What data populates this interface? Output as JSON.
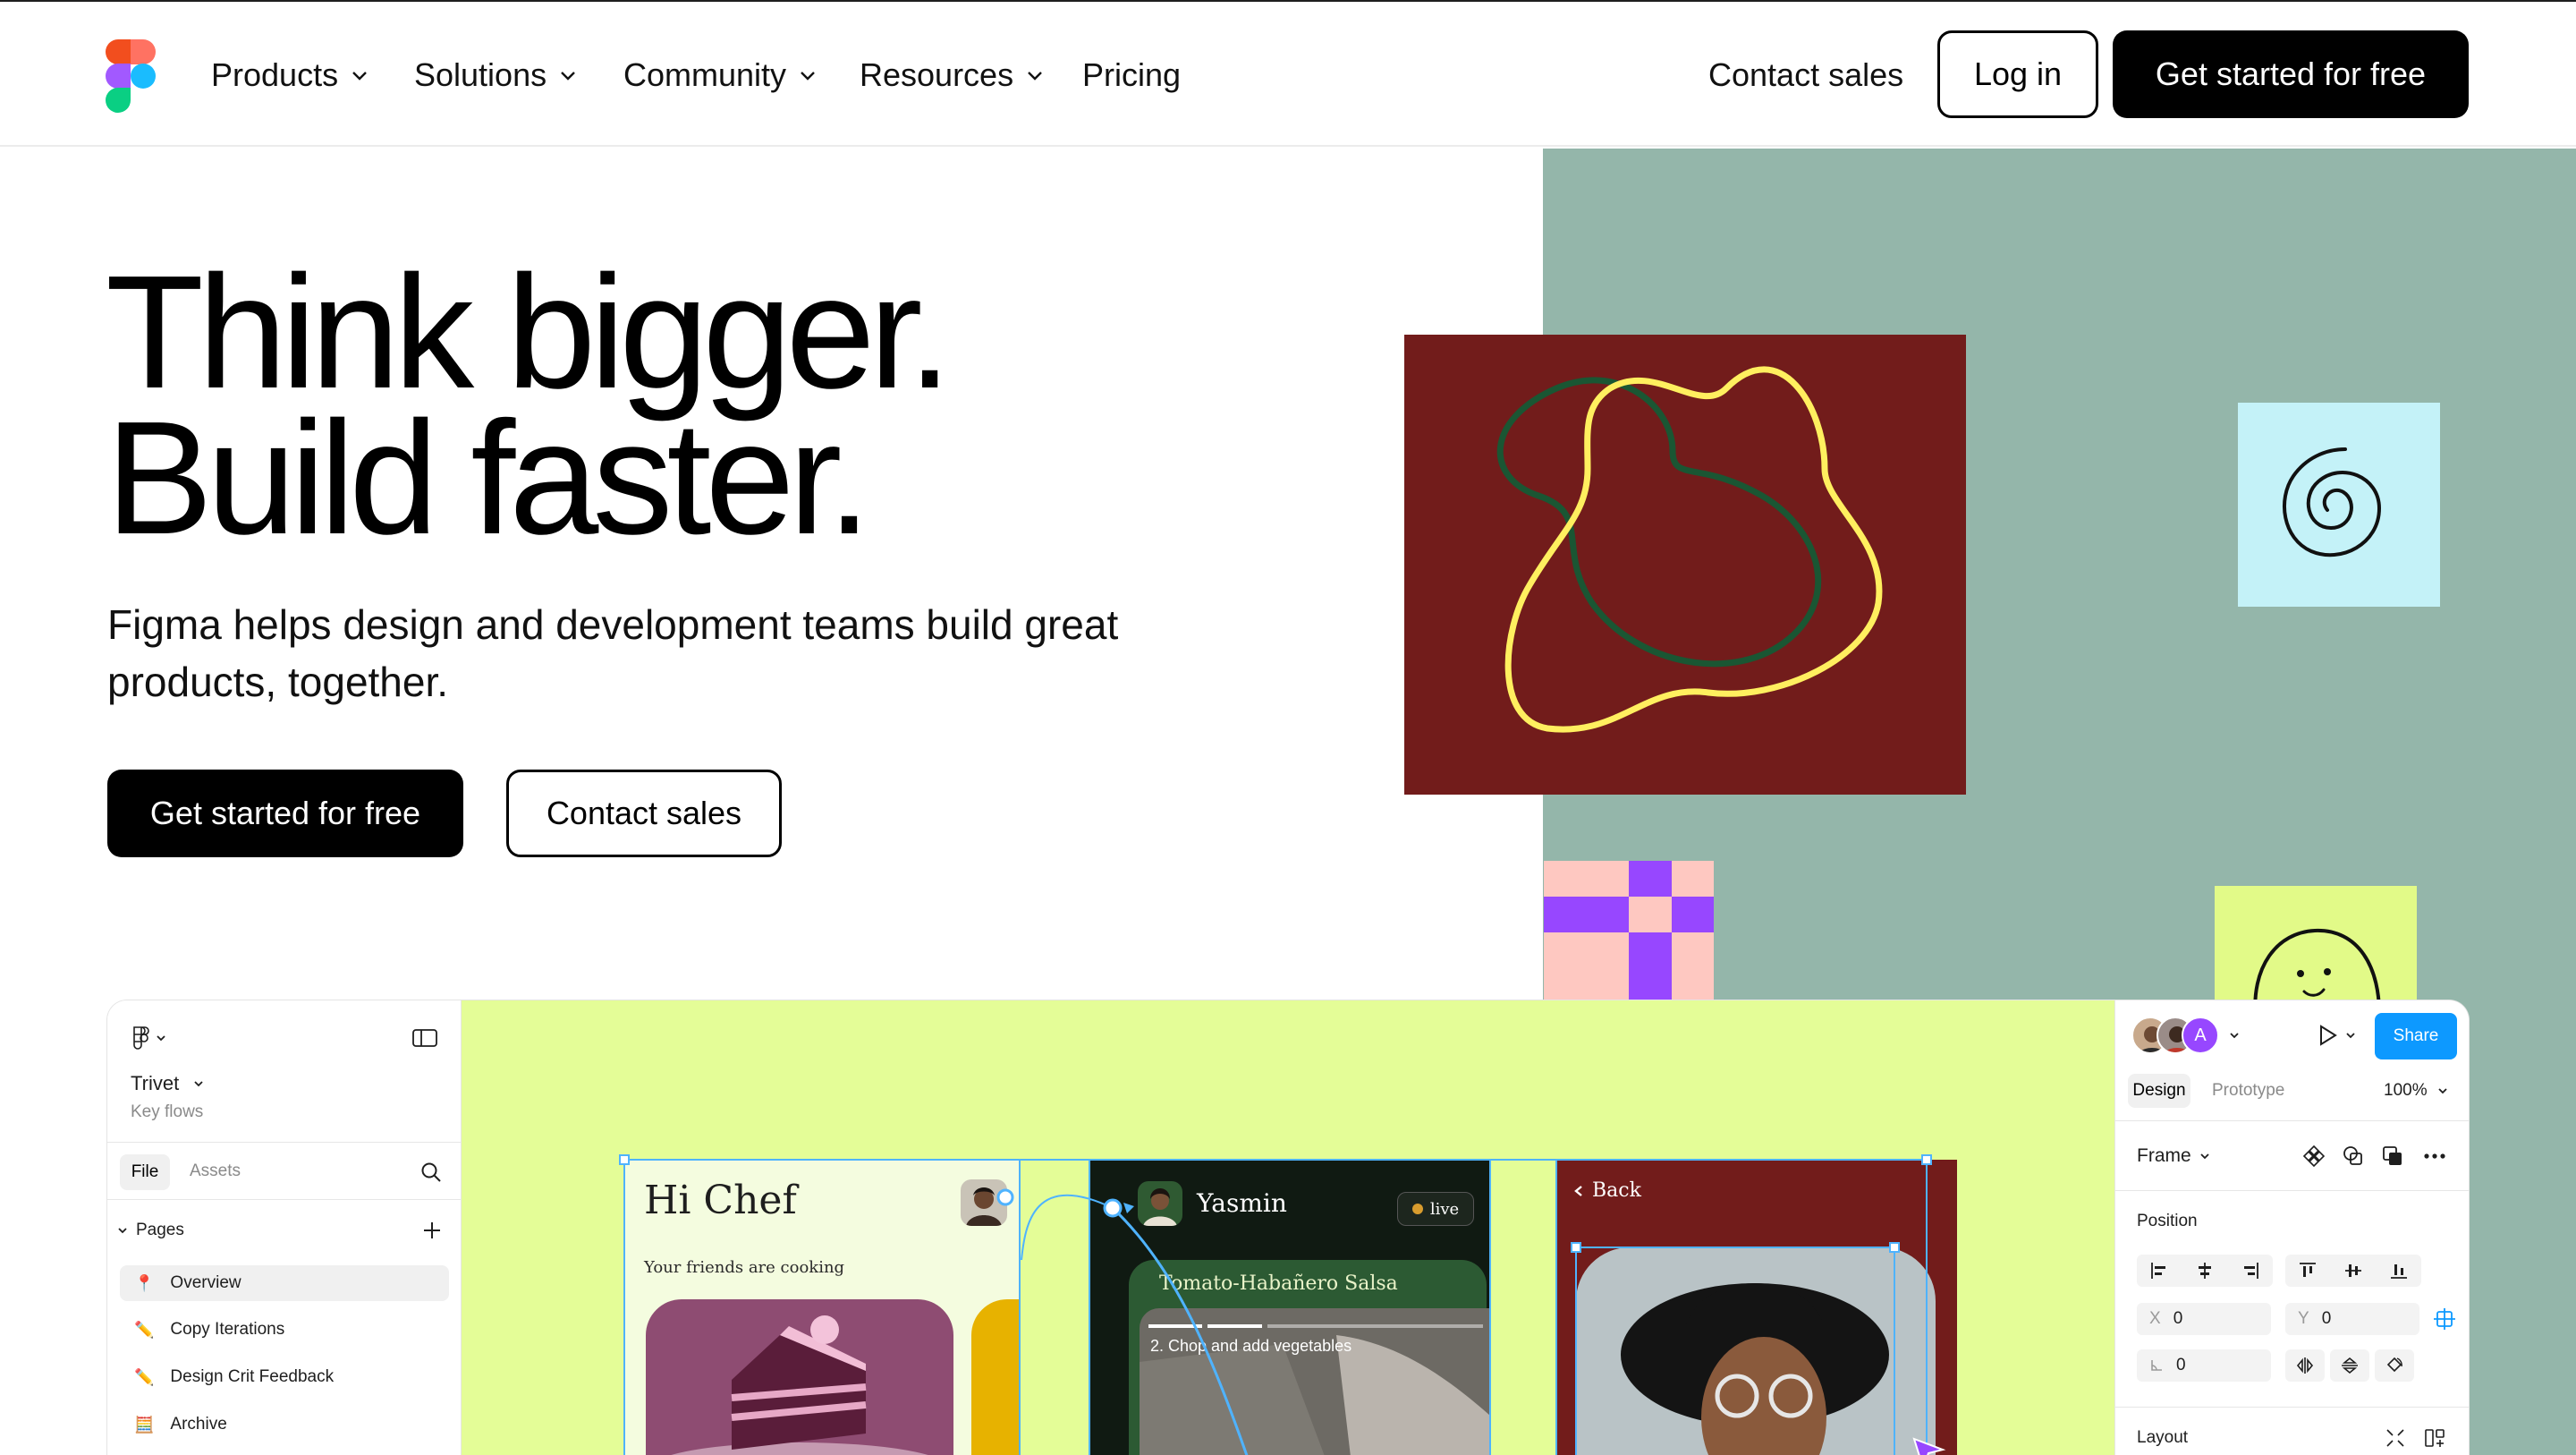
{
  "nav": {
    "items": [
      {
        "label": "Products",
        "dropdown": true
      },
      {
        "label": "Solutions",
        "dropdown": true
      },
      {
        "label": "Community",
        "dropdown": true
      },
      {
        "label": "Resources",
        "dropdown": true
      },
      {
        "label": "Pricing",
        "dropdown": false
      }
    ],
    "contact_sales": "Contact sales",
    "login": "Log in",
    "get_started": "Get started for free"
  },
  "hero": {
    "title_line1": "Think bigger.",
    "title_line2": "Build faster.",
    "subtitle": "Figma helps design and development teams build great products, together.",
    "cta_primary": "Get started for free",
    "cta_secondary": "Contact sales"
  },
  "colors": {
    "sage": "#94b6aa",
    "maroon": "#721c1b",
    "cyan": "#c4f2f8",
    "lime": "#e4fd97",
    "purple": "#9747ff",
    "pink": "#fec8c1",
    "share_blue": "#0d99ff"
  },
  "app": {
    "left_panel": {
      "file_name": "Trivet",
      "file_subtitle": "Key flows",
      "tabs": [
        "File",
        "Assets"
      ],
      "active_tab": "File",
      "pages_heading": "Pages",
      "pages": [
        {
          "icon": "pin-icon",
          "label": "Overview",
          "active": true
        },
        {
          "icon": "pencil-icon",
          "label": "Copy Iterations",
          "active": false
        },
        {
          "icon": "pencil-icon",
          "label": "Design Crit Feedback",
          "active": false
        },
        {
          "icon": "abacus-icon",
          "label": "Archive",
          "active": false
        }
      ]
    },
    "canvas": {
      "frame1": {
        "title": "Hi Chef",
        "subtitle": "Your friends are cooking"
      },
      "frame2": {
        "name": "Yasmin",
        "badge": "live",
        "recipe": "Tomato-Habañero Salsa",
        "step": "2.  Chop and add vegetables"
      },
      "frame3": {
        "back": "Back"
      }
    },
    "right_panel": {
      "avatar_letter": "A",
      "share": "Share",
      "tabs": [
        "Design",
        "Prototype"
      ],
      "active_tab": "Design",
      "zoom": "100%",
      "frame_label": "Frame",
      "position_heading": "Position",
      "x_label": "X",
      "x_value": "0",
      "y_label": "Y",
      "y_value": "0",
      "rotation_value": "0",
      "layout_heading": "Layout"
    }
  }
}
